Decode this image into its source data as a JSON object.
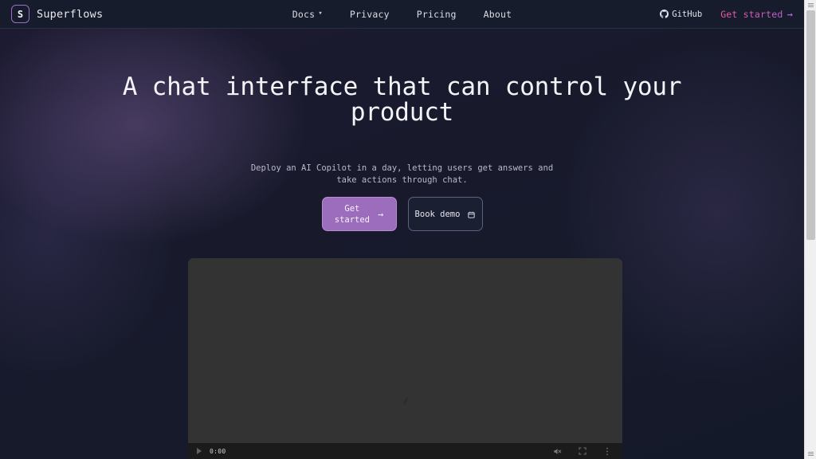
{
  "brand": {
    "mark_letter": "S",
    "name": "Superflows",
    "mark_icon": "superflows-logo-icon"
  },
  "nav": {
    "links": [
      {
        "label": "Docs",
        "has_dropdown": true,
        "caret_icon": "chevron-down-icon"
      },
      {
        "label": "Privacy",
        "has_dropdown": false
      },
      {
        "label": "Pricing",
        "has_dropdown": false
      },
      {
        "label": "About",
        "has_dropdown": false
      }
    ],
    "github": {
      "label": "GitHub",
      "icon": "github-icon"
    },
    "cta": {
      "label": "Get started",
      "arrow": "→",
      "icon": "arrow-right-icon"
    }
  },
  "hero": {
    "headline": "A chat interface that can control your product",
    "subhead": "Deploy an AI Copilot in a day, letting users get answers and take actions through chat.",
    "primary_cta": {
      "label": "Get\nstarted",
      "arrow": "→",
      "icon": "arrow-right-icon"
    },
    "secondary_cta": {
      "label": "Book demo",
      "icon": "calendar-icon"
    }
  },
  "video": {
    "current_time": "0:00",
    "play_icon": "play-icon",
    "mute_icon": "volume-muted-icon",
    "fullscreen_icon": "fullscreen-icon",
    "menu_icon": "more-options-icon"
  },
  "colors": {
    "page_bg": "#141929",
    "nav_bg": "#171c2c",
    "accent_purple": "#9c6cbd",
    "accent_pink": "#ef58a0",
    "video_bg": "#333333"
  },
  "browser": {
    "scrollbar_up_icon": "scroll-up-icon",
    "scrollbar_down_icon": "scroll-down-icon"
  }
}
